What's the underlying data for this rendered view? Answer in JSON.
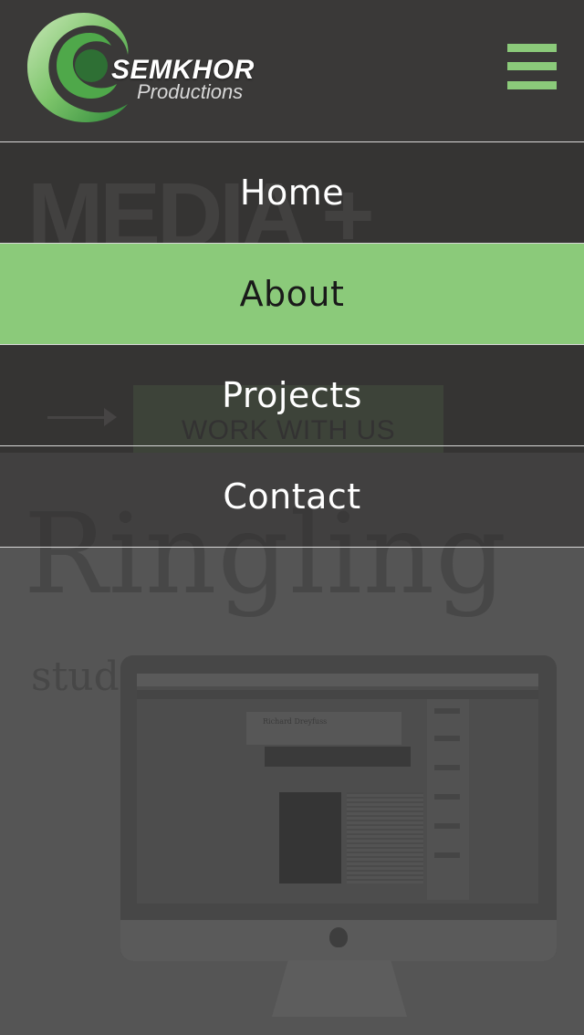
{
  "header": {
    "logo_title": "SEMKHOR",
    "logo_subtitle": "Productions",
    "menu_icon": "hamburger-icon"
  },
  "menu": {
    "items": [
      {
        "label": "Home",
        "active": false
      },
      {
        "label": "About",
        "active": true
      },
      {
        "label": "Projects",
        "active": false
      },
      {
        "label": "Contact",
        "active": false
      }
    ]
  },
  "hero": {
    "headline": "MEDIA +",
    "cta_label": "WORK WITH US",
    "arrow_icon": "arrow-right-icon"
  },
  "featured": {
    "client": "Ringling",
    "client_sub": "studio lab.",
    "screen_title": "Richard Dreyfuss"
  },
  "colors": {
    "accent": "#8bca7a",
    "header_bg": "#3a3938",
    "overlay_bg": "#555555",
    "menu_text": "#ffffff",
    "active_text": "#1a1a1a"
  }
}
